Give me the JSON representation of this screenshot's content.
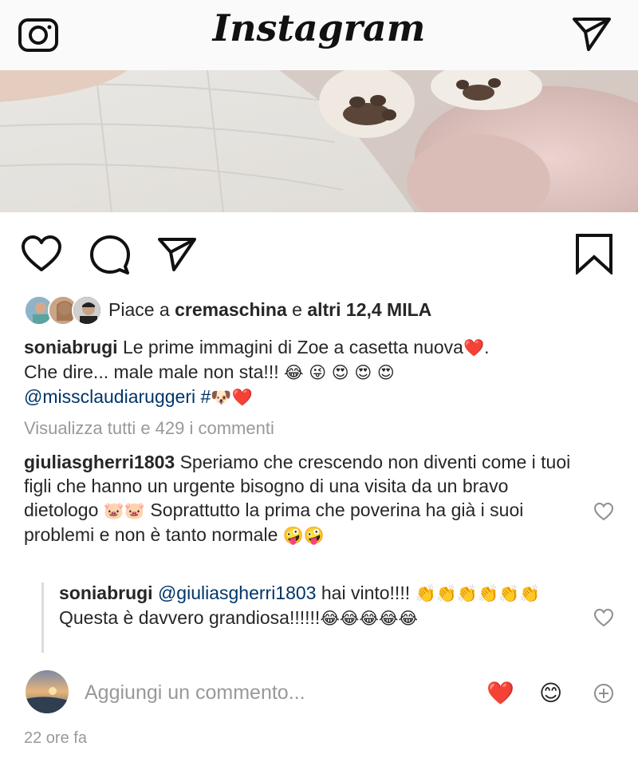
{
  "header": {
    "logo": "Instagram",
    "camera_icon": "camera-icon",
    "direct_icon": "paper-plane-icon"
  },
  "actions": {
    "like_icon": "heart-outline-icon",
    "comment_icon": "comment-bubble-icon",
    "share_icon": "paper-plane-icon",
    "save_icon": "bookmark-icon"
  },
  "likes": {
    "prefix": "Piace a ",
    "user": "cremaschina",
    "middle": " e ",
    "count": "altri 12,4 MILA"
  },
  "caption": {
    "user": "soniabrugi",
    "text1": " Le prime immagini di Zoe a casetta nuova",
    "emoji1": "❤️",
    "text1b": ".",
    "text2": "Che dire... male male non sta!!! ",
    "emoji2": "😂 😜 😍 😍 😍",
    "mention": "@missclaudiaruggeri",
    "hashtag": " #",
    "emoji3": "🐶❤️"
  },
  "view_all": "Visualizza tutti e 429 i commenti",
  "comments": [
    {
      "user": "giuliasgherri1803",
      "text_a": " Speriamo che crescendo non diventi come i tuoi figli che hanno un urgente bisogno di una visita da un bravo dietologo ",
      "emoji_a": "🐷🐷",
      "text_b": " Soprattutto la prima che poverina ha già i suoi problemi e non è tanto normale ",
      "emoji_b": "🤪🤪"
    }
  ],
  "reply": {
    "user": "soniabrugi",
    "mention": "@giuliasgherri1803",
    "text_a": " hai vinto!!!! ",
    "emoji_a": "👏👏👏👏👏👏",
    "text_b": " Questa è davvero grandiosa!!!!!!",
    "emoji_b": "😂😂😂😂😂"
  },
  "add_comment": {
    "placeholder": "Aggiungi un commento...",
    "quick1": "❤️",
    "quick2": "😊"
  },
  "timestamp": "22 ore fa",
  "colors": {
    "text": "#262626",
    "muted": "#999999",
    "mention": "#003569",
    "header_bg": "#fafafa"
  }
}
